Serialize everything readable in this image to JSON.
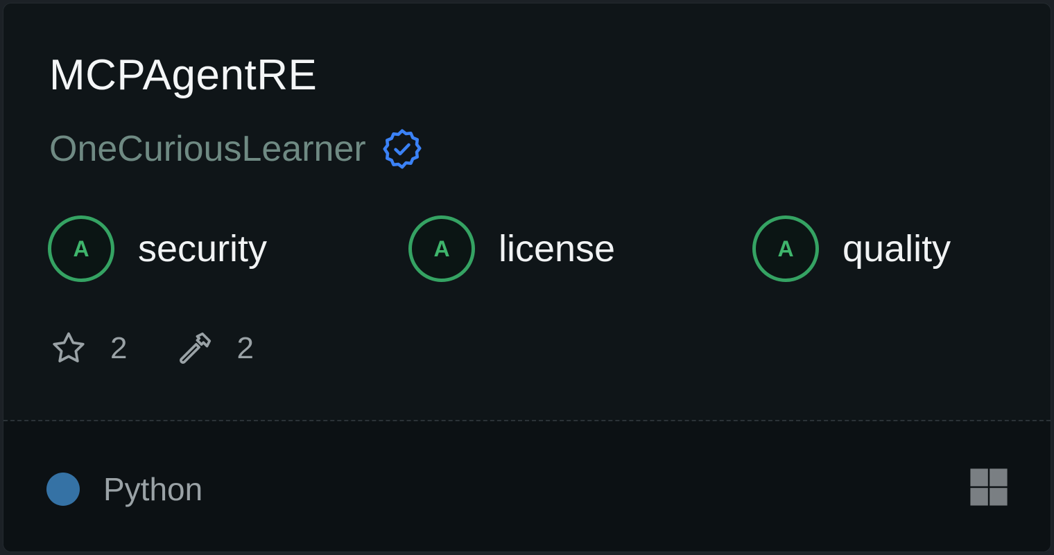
{
  "card": {
    "title": "MCPAgentRE",
    "author": "OneCuriousLearner",
    "author_badge_icon": "verified-badge-icon",
    "grades": [
      {
        "grade": "A",
        "label": "security"
      },
      {
        "grade": "A",
        "label": "license"
      },
      {
        "grade": "A",
        "label": "quality"
      }
    ],
    "stats": {
      "stars": "2",
      "tools": "2"
    },
    "footer": {
      "language": "Python",
      "language_color": "#3572a5",
      "platform_icon": "windows-icon"
    }
  },
  "colors": {
    "background": "#0f1518",
    "grade_green": "#35a363",
    "verified_blue": "#3b82f6",
    "author_text": "#6f8a83"
  }
}
